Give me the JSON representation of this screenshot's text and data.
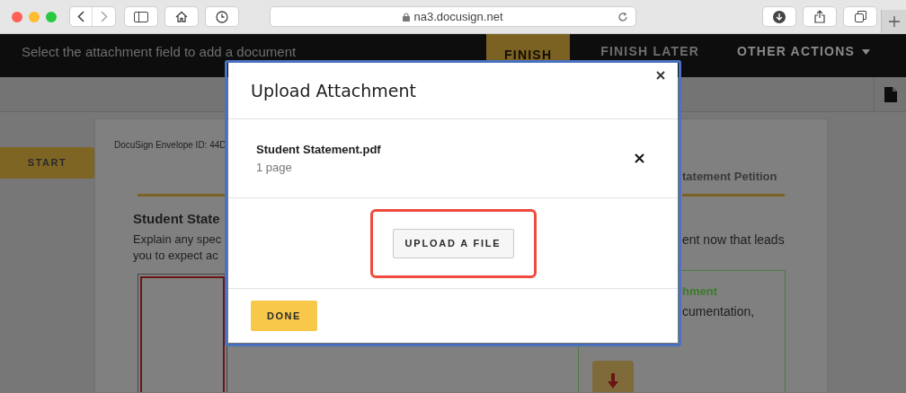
{
  "browser": {
    "url": "na3.docusign.net"
  },
  "header": {
    "message": "Select the attachment field to add a document",
    "actions": [
      {
        "label": "FINISH",
        "kind": "primary"
      },
      {
        "label": "FINISH LATER",
        "kind": "link"
      },
      {
        "label": "OTHER ACTIONS",
        "kind": "menu"
      }
    ]
  },
  "sidebar": {
    "start": "START"
  },
  "document": {
    "envelope_id": "DocuSign Envelope ID: 44D",
    "left": {
      "heading": "Student State",
      "lines": [
        "Explain any spec",
        "you to expect ac"
      ]
    },
    "right": {
      "heading": "tatement Petition",
      "lines": [
        "ent now that leads"
      ],
      "attachment_title": "hment",
      "attachment_text": "cumentation,"
    }
  },
  "modal": {
    "title": "Upload Attachment",
    "files": [
      {
        "name": "Student Statement.pdf",
        "pages": "1 page"
      }
    ],
    "upload_button": "UPLOAD A FILE",
    "done_button": "DONE"
  }
}
